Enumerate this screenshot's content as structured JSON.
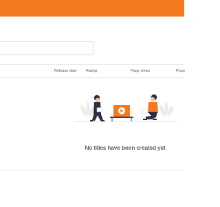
{
  "colors": {
    "accent": "#f47a1f",
    "divider": "#ececec"
  },
  "search": {
    "value": "",
    "placeholder": ""
  },
  "table": {
    "columns": [
      "Release date",
      "Rating",
      "Page views",
      "Popu"
    ]
  },
  "empty_state": {
    "illustration_icon": "two-people-with-video-laptop",
    "message": "No titles have been created yet"
  }
}
